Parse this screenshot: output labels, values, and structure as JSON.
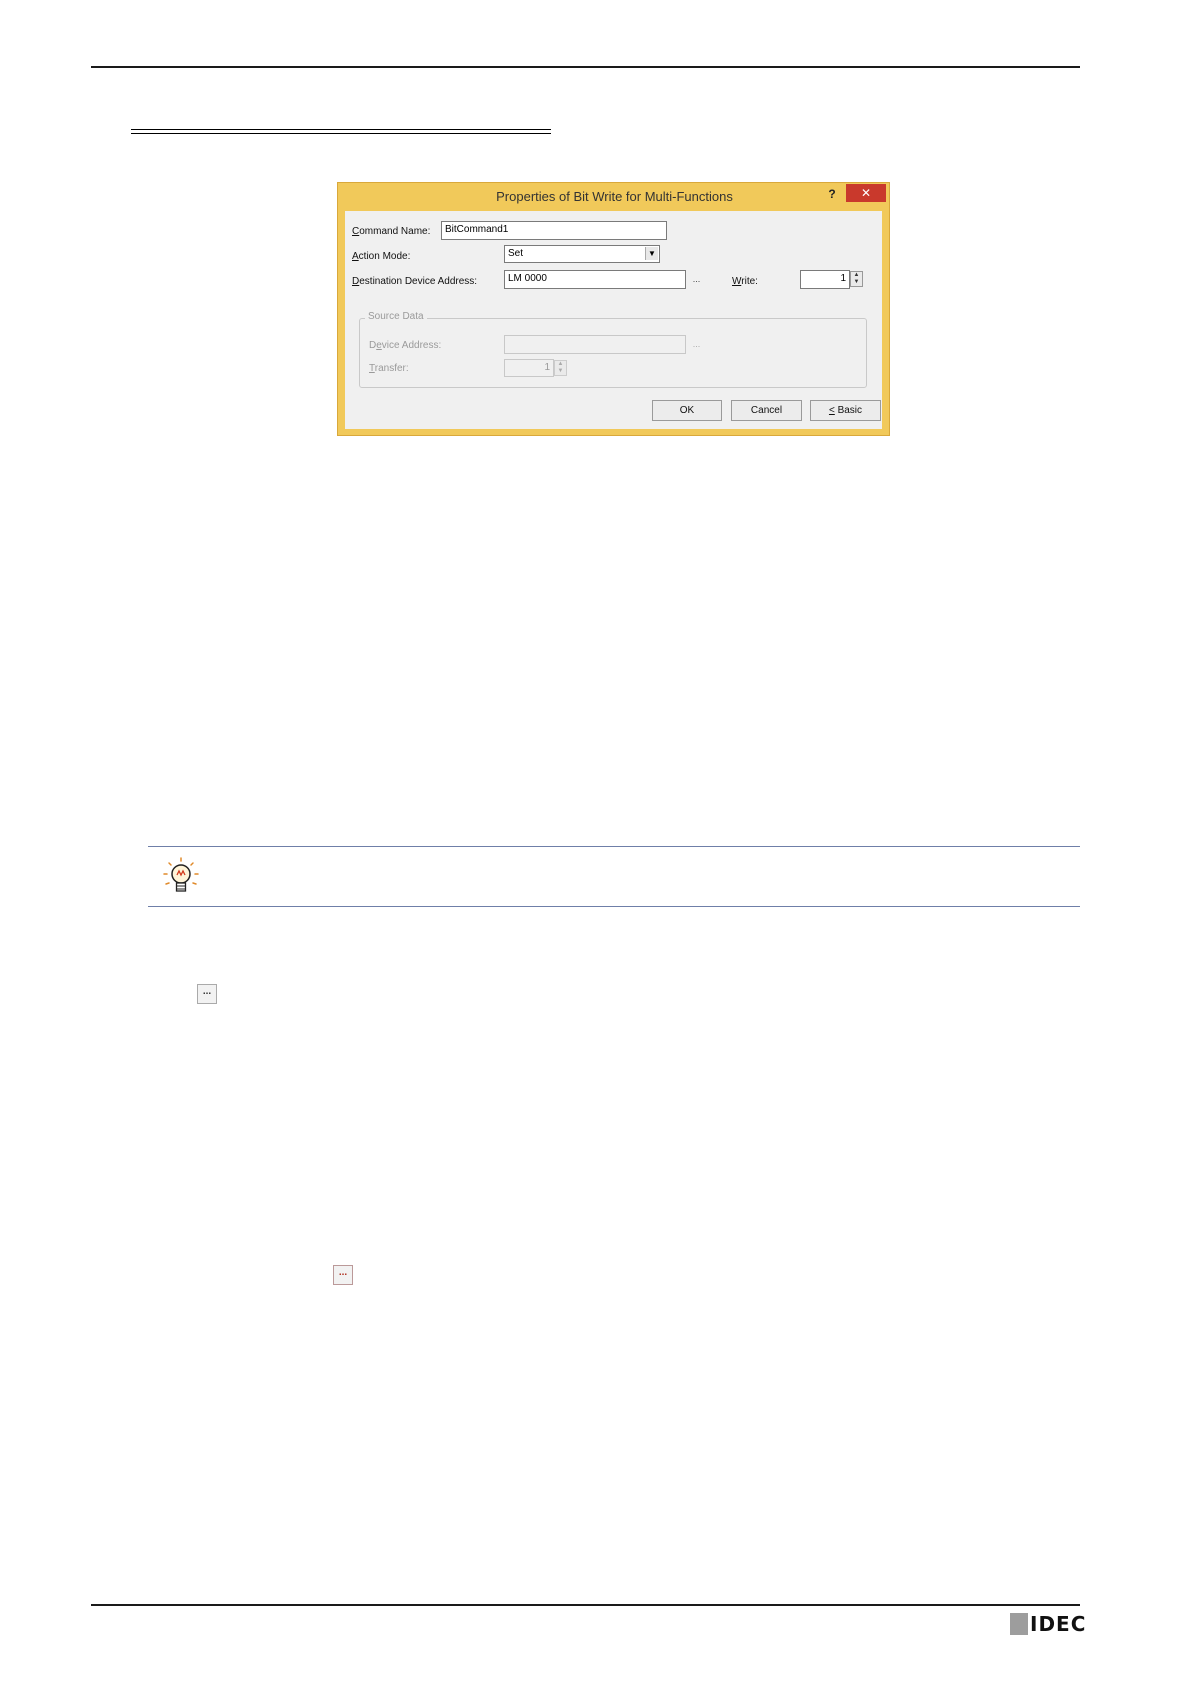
{
  "dialog": {
    "title": "Properties of Bit Write for Multi-Functions",
    "help_label": "?",
    "close_label": "✕",
    "command_name": {
      "label_key": "C",
      "label_rest": "ommand Name:",
      "value": "BitCommand1"
    },
    "action_mode": {
      "label_key": "A",
      "label_rest": "ction Mode:",
      "value": "Set"
    },
    "destination": {
      "label_key": "D",
      "label_rest": "estination Device Address:",
      "value": "LM 0000",
      "browse": "..."
    },
    "write": {
      "label_key": "W",
      "label_rest": "rite:",
      "value": "1"
    },
    "source_data": {
      "legend": "Source Data",
      "device_address": {
        "label_pre": "D",
        "label_key": "e",
        "label_rest": "vice Address:",
        "value": "",
        "browse": "..."
      },
      "transfer": {
        "label_key": "T",
        "label_rest": "ransfer:",
        "value": "1"
      }
    },
    "buttons": {
      "ok": "OK",
      "cancel": "Cancel",
      "basic_key": "<",
      "basic_rest": " Basic"
    }
  },
  "inline_buttons": {
    "first": "...",
    "second": "..."
  },
  "logo": {
    "text": "IDEC"
  },
  "icons": {
    "tip": "lightbulb-icon",
    "dropdown": "chevron-down-icon"
  }
}
